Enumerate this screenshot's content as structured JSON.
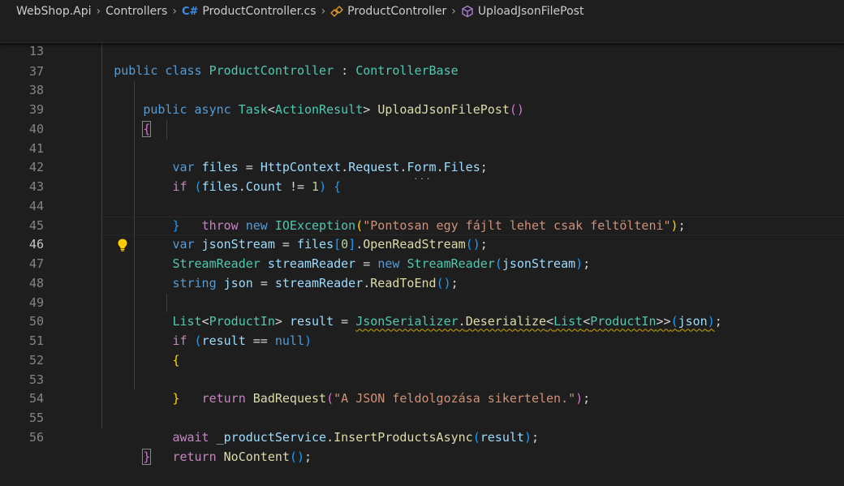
{
  "breadcrumb": {
    "project": "WebShop.Api",
    "folder": "Controllers",
    "file": "ProductController.cs",
    "class_name": "ProductController",
    "method": "UploadJsonFilePost",
    "file_icon": "csharp-file-icon",
    "class_icon": "class-symbol-icon",
    "method_icon": "method-symbol-icon"
  },
  "colors": {
    "background": "#1e1e1e",
    "keyword": "#569cd6",
    "control_keyword": "#c586c0",
    "type": "#4ec9b0",
    "function": "#dcdcaa",
    "variable": "#9cdcfe",
    "string": "#ce9178",
    "number": "#b5cea8",
    "warning_squiggle": "#cca700"
  },
  "editor": {
    "current_line": "46",
    "lines": [
      {
        "num": "13",
        "t": [
          "public",
          "class",
          "ProductController",
          ":",
          "ControllerBase"
        ]
      },
      {
        "num": "37",
        "t": [
          "public",
          "async",
          "Task",
          "<",
          "ActionResult",
          ">",
          "UploadJsonFilePost",
          "(",
          ")"
        ]
      },
      {
        "num": "38",
        "t": [
          "{"
        ]
      },
      {
        "num": "39",
        "t": [
          "var",
          "files",
          "=",
          "HttpContext",
          ".",
          "Request",
          ".",
          "Form",
          ".",
          "Files",
          ";"
        ]
      },
      {
        "num": "40",
        "t": [
          "if",
          "(",
          "files",
          ".",
          "Count",
          "!=",
          "1",
          ")",
          "{"
        ]
      },
      {
        "num": "41",
        "t": [
          "throw",
          "new",
          "IOException",
          "(",
          "\"Pontosan egy fájlt lehet csak feltölteni\"",
          ")",
          ";"
        ]
      },
      {
        "num": "42",
        "t": [
          "}"
        ]
      },
      {
        "num": "43",
        "t": [
          "var",
          "jsonStream",
          "=",
          "files",
          "[",
          "0",
          "]",
          ".",
          "OpenReadStream",
          "(",
          ")",
          ";"
        ]
      },
      {
        "num": "44",
        "t": [
          "StreamReader",
          "streamReader",
          "=",
          "new",
          "StreamReader",
          "(",
          "jsonStream",
          ")",
          ";"
        ]
      },
      {
        "num": "45",
        "t": [
          "string",
          "json",
          "=",
          "streamReader",
          ".",
          "ReadToEnd",
          "(",
          ")",
          ";"
        ]
      },
      {
        "num": "46",
        "t": [
          "List",
          "<",
          "ProductIn",
          ">",
          "result",
          "=",
          "JsonSerializer",
          ".",
          "Deserialize",
          "<",
          "List",
          "<",
          "ProductIn",
          ">>",
          "(",
          "json",
          ")",
          ";"
        ]
      },
      {
        "num": "47",
        "t": []
      },
      {
        "num": "48",
        "t": [
          "if",
          "(",
          "result",
          "==",
          "null",
          ")"
        ]
      },
      {
        "num": "49",
        "t": [
          "{"
        ]
      },
      {
        "num": "50",
        "t": [
          "return",
          "BadRequest",
          "(",
          "\"A JSON feldolgozása sikertelen.\"",
          ")",
          ";"
        ]
      },
      {
        "num": "51",
        "t": [
          "}"
        ]
      },
      {
        "num": "52",
        "t": []
      },
      {
        "num": "53",
        "t": [
          "await",
          "_productService",
          ".",
          "InsertProductsAsync",
          "(",
          "result",
          ")",
          ";"
        ]
      },
      {
        "num": "54",
        "t": [
          "return",
          "NoContent",
          "(",
          ")",
          ";"
        ]
      },
      {
        "num": "55",
        "t": [
          "}"
        ]
      },
      {
        "num": "56",
        "t": []
      }
    ],
    "lightbulb_icon": "lightbulb-icon"
  }
}
